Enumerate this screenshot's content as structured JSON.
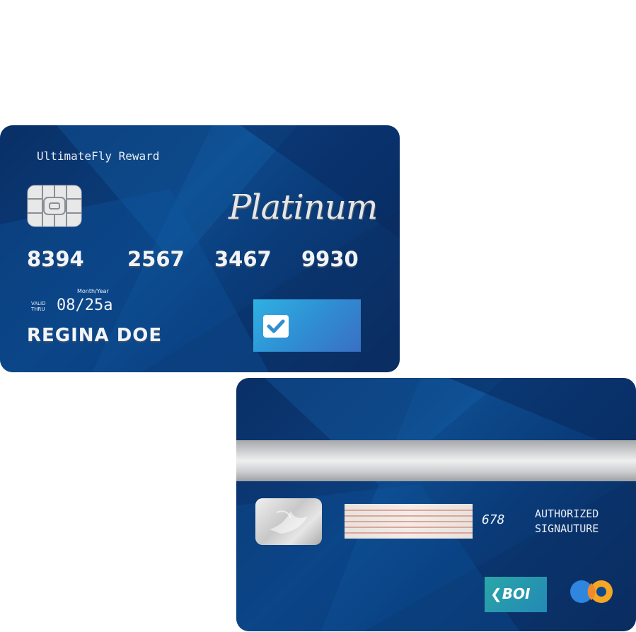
{
  "front": {
    "brand": "UltimateFly Reward",
    "tier": "Platinum",
    "number_groups": [
      "8394",
      "2567",
      "3467",
      "9930"
    ],
    "month_year_label": "Month/Year",
    "valid_thru_label": "VALID THRU",
    "expiry": "08/25a",
    "holder": "REGINA DOE"
  },
  "back": {
    "cvv": "678",
    "authorized_line1": "AUTHORIZED",
    "authorized_line2": "SIGNAUTURE",
    "bank_logo": "BOI"
  },
  "icons": {
    "chip": "chip-icon",
    "checkmark": "checkmark-icon",
    "hologram": "dove-hologram-icon",
    "bank_arrow": "chevron-left-icon",
    "network": "interlocking-circles-icon"
  },
  "colors": {
    "card_dark": "#0b2a5c",
    "card_mid": "#0d4a8c",
    "badge_light": "#2fb1e3",
    "network_blue": "#2e86de",
    "network_orange": "#f5a623"
  }
}
